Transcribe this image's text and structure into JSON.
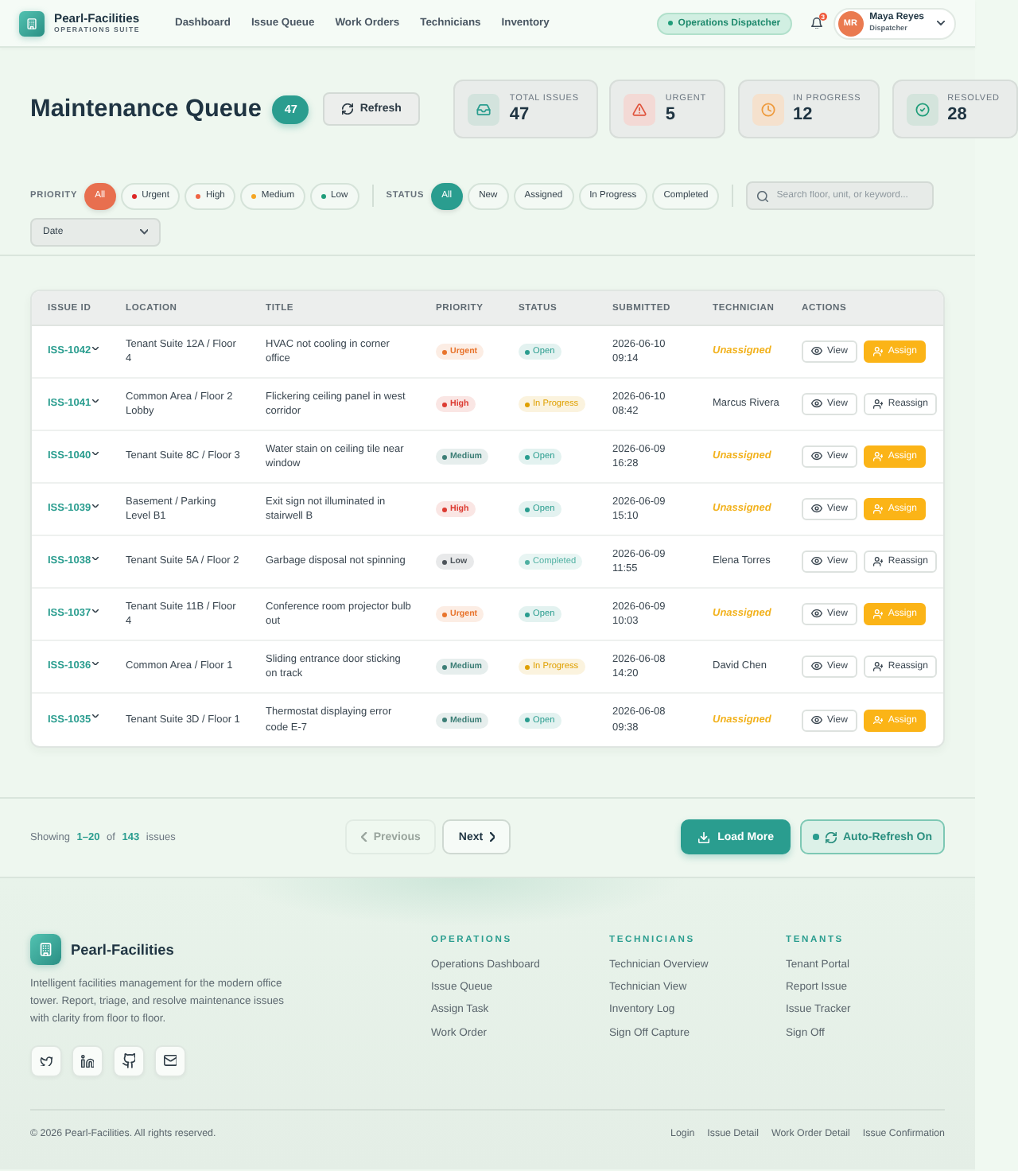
{
  "header": {
    "brand": {
      "name": "Pearl-Facilities",
      "tagline": "OPERATIONS SUITE"
    },
    "nav": [
      {
        "label": "Dashboard",
        "selected": false
      },
      {
        "label": "Issue Queue",
        "selected": false
      },
      {
        "label": "Work Orders",
        "selected": false
      },
      {
        "label": "Technicians",
        "selected": false
      },
      {
        "label": "Inventory",
        "selected": false
      }
    ],
    "role_badge": "Operations Dispatcher",
    "notifications": {
      "count": "3"
    },
    "user": {
      "initials": "MR",
      "name": "Maya Reyes",
      "role": "Dispatcher"
    }
  },
  "page_header": {
    "title": "Maintenance Queue",
    "count": "47",
    "refresh_button": "Refresh"
  },
  "stats": [
    {
      "kind": "total",
      "label": "TOTAL ISSUES",
      "value": "47"
    },
    {
      "kind": "urgent",
      "label": "URGENT",
      "value": "5"
    },
    {
      "kind": "progress",
      "label": "IN PROGRESS",
      "value": "12"
    },
    {
      "kind": "resolved",
      "label": "RESOLVED",
      "value": "28"
    }
  ],
  "filters": {
    "priority": {
      "label": "PRIORITY",
      "options": [
        {
          "label": "All",
          "selected": true
        },
        {
          "label": "Urgent",
          "selected": false,
          "color": "#dc2626"
        },
        {
          "label": "High",
          "selected": false,
          "color": "#ef6444"
        },
        {
          "label": "Medium",
          "selected": false,
          "color": "#f5a524"
        },
        {
          "label": "Low",
          "selected": false,
          "color": "#1f9d7a"
        }
      ]
    },
    "status": {
      "label": "STATUS",
      "options": [
        {
          "label": "All",
          "selected": true
        },
        {
          "label": "New",
          "selected": false
        },
        {
          "label": "Assigned",
          "selected": false
        },
        {
          "label": "In Progress",
          "selected": false
        },
        {
          "label": "Completed",
          "selected": false
        }
      ]
    },
    "search": {
      "placeholder": "Search floor, unit, or keyword..."
    },
    "sort": {
      "value": "Date"
    }
  },
  "table": {
    "columns": [
      "ISSUE ID",
      "LOCATION",
      "TITLE",
      "PRIORITY",
      "STATUS",
      "SUBMITTED",
      "TECHNICIAN",
      "ACTIONS"
    ],
    "rows": [
      {
        "issue_id": "ISS-1042",
        "location": "Tenant Suite 12A / Floor 4",
        "title": "HVAC not cooling in corner office",
        "priority": {
          "label": "Urgent",
          "color": "#e8742c"
        },
        "status": {
          "label": "Open",
          "color": "#2a9d8f"
        },
        "submitted": "2026-06-10 09:14",
        "technician": {
          "name": "Unassigned",
          "assigned": false
        },
        "actions": [
          {
            "kind": "view",
            "label": "View"
          },
          {
            "kind": "assign",
            "label": "Assign"
          }
        ]
      },
      {
        "issue_id": "ISS-1041",
        "location": "Common Area / Floor 2 Lobby",
        "title": "Flickering ceiling panel in west corridor",
        "priority": {
          "label": "High",
          "color": "#dc3b32"
        },
        "status": {
          "label": "In Progress",
          "color": "#dfa000"
        },
        "submitted": "2026-06-10 08:42",
        "technician": {
          "name": "Marcus Rivera",
          "assigned": true
        },
        "actions": [
          {
            "kind": "view",
            "label": "View"
          },
          {
            "kind": "reassign",
            "label": "Reassign"
          }
        ]
      },
      {
        "issue_id": "ISS-1040",
        "location": "Tenant Suite 8C / Floor 3",
        "title": "Water stain on ceiling tile near window",
        "priority": {
          "label": "Medium",
          "color": "#3d7f77"
        },
        "status": {
          "label": "Open",
          "color": "#2a9d8f"
        },
        "submitted": "2026-06-09 16:28",
        "technician": {
          "name": "Unassigned",
          "assigned": false
        },
        "actions": [
          {
            "kind": "view",
            "label": "View"
          },
          {
            "kind": "assign",
            "label": "Assign"
          }
        ]
      },
      {
        "issue_id": "ISS-1039",
        "location": "Basement / Parking Level B1",
        "title": "Exit sign not illuminated in stairwell B",
        "priority": {
          "label": "High",
          "color": "#dc3b32"
        },
        "status": {
          "label": "Open",
          "color": "#2a9d8f"
        },
        "submitted": "2026-06-09 15:10",
        "technician": {
          "name": "Unassigned",
          "assigned": false
        },
        "actions": [
          {
            "kind": "view",
            "label": "View"
          },
          {
            "kind": "assign",
            "label": "Assign"
          }
        ]
      },
      {
        "issue_id": "ISS-1038",
        "location": "Tenant Suite 5A / Floor 2",
        "title": "Garbage disposal not spinning",
        "priority": {
          "label": "Low",
          "color": "#4d545a"
        },
        "status": {
          "label": "Completed",
          "color": "#4fb0a2"
        },
        "submitted": "2026-06-09 11:55",
        "technician": {
          "name": "Elena Torres",
          "assigned": true
        },
        "actions": [
          {
            "kind": "view",
            "label": "View"
          },
          {
            "kind": "reassign",
            "label": "Reassign"
          }
        ]
      },
      {
        "issue_id": "ISS-1037",
        "location": "Tenant Suite 11B / Floor 4",
        "title": "Conference room projector bulb out",
        "priority": {
          "label": "Urgent",
          "color": "#e8742c"
        },
        "status": {
          "label": "Open",
          "color": "#2a9d8f"
        },
        "submitted": "2026-06-09 10:03",
        "technician": {
          "name": "Unassigned",
          "assigned": false
        },
        "actions": [
          {
            "kind": "view",
            "label": "View"
          },
          {
            "kind": "assign",
            "label": "Assign"
          }
        ]
      },
      {
        "issue_id": "ISS-1036",
        "location": "Common Area / Floor 1",
        "title": "Sliding entrance door sticking on track",
        "priority": {
          "label": "Medium",
          "color": "#3d7f77"
        },
        "status": {
          "label": "In Progress",
          "color": "#dfa000"
        },
        "submitted": "2026-06-08 14:20",
        "technician": {
          "name": "David Chen",
          "assigned": true
        },
        "actions": [
          {
            "kind": "view",
            "label": "View"
          },
          {
            "kind": "reassign",
            "label": "Reassign"
          }
        ]
      },
      {
        "issue_id": "ISS-1035",
        "location": "Tenant Suite 3D / Floor 1",
        "title": "Thermostat displaying error code E-7",
        "priority": {
          "label": "Medium",
          "color": "#3d7f77"
        },
        "status": {
          "label": "Open",
          "color": "#2a9d8f"
        },
        "submitted": "2026-06-08 09:38",
        "technician": {
          "name": "Unassigned",
          "assigned": false
        },
        "actions": [
          {
            "kind": "view",
            "label": "View"
          },
          {
            "kind": "assign",
            "label": "Assign"
          }
        ]
      }
    ]
  },
  "pager": {
    "summary": "Showing **1–20** of **143** issues",
    "previous": {
      "label": "Previous",
      "disabled": true
    },
    "next": {
      "label": "Next",
      "disabled": false
    },
    "load_more": "Load More",
    "auto_refresh": {
      "label": "Auto-Refresh On",
      "on": true
    }
  },
  "footer": {
    "brand": "Pearl-Facilities",
    "description": "Intelligent facilities management for the modern office tower. Report, triage, and resolve maintenance issues with clarity from floor to floor.",
    "columns": [
      {
        "heading": "OPERATIONS",
        "links": [
          "Operations Dashboard",
          "Issue Queue",
          "Assign Task",
          "Work Order"
        ]
      },
      {
        "heading": "TECHNICIANS",
        "links": [
          "Technician Overview",
          "Technician View",
          "Inventory Log",
          "Sign Off Capture"
        ]
      },
      {
        "heading": "TENANTS",
        "links": [
          "Tenant Portal",
          "Report Issue",
          "Issue Tracker",
          "Sign Off"
        ]
      }
    ],
    "copyright": "© 2026 Pearl-Facilities. All rights reserved.",
    "links": [
      "Login",
      "Issue Detail",
      "Work Order Detail",
      "Issue Confirmation"
    ]
  }
}
